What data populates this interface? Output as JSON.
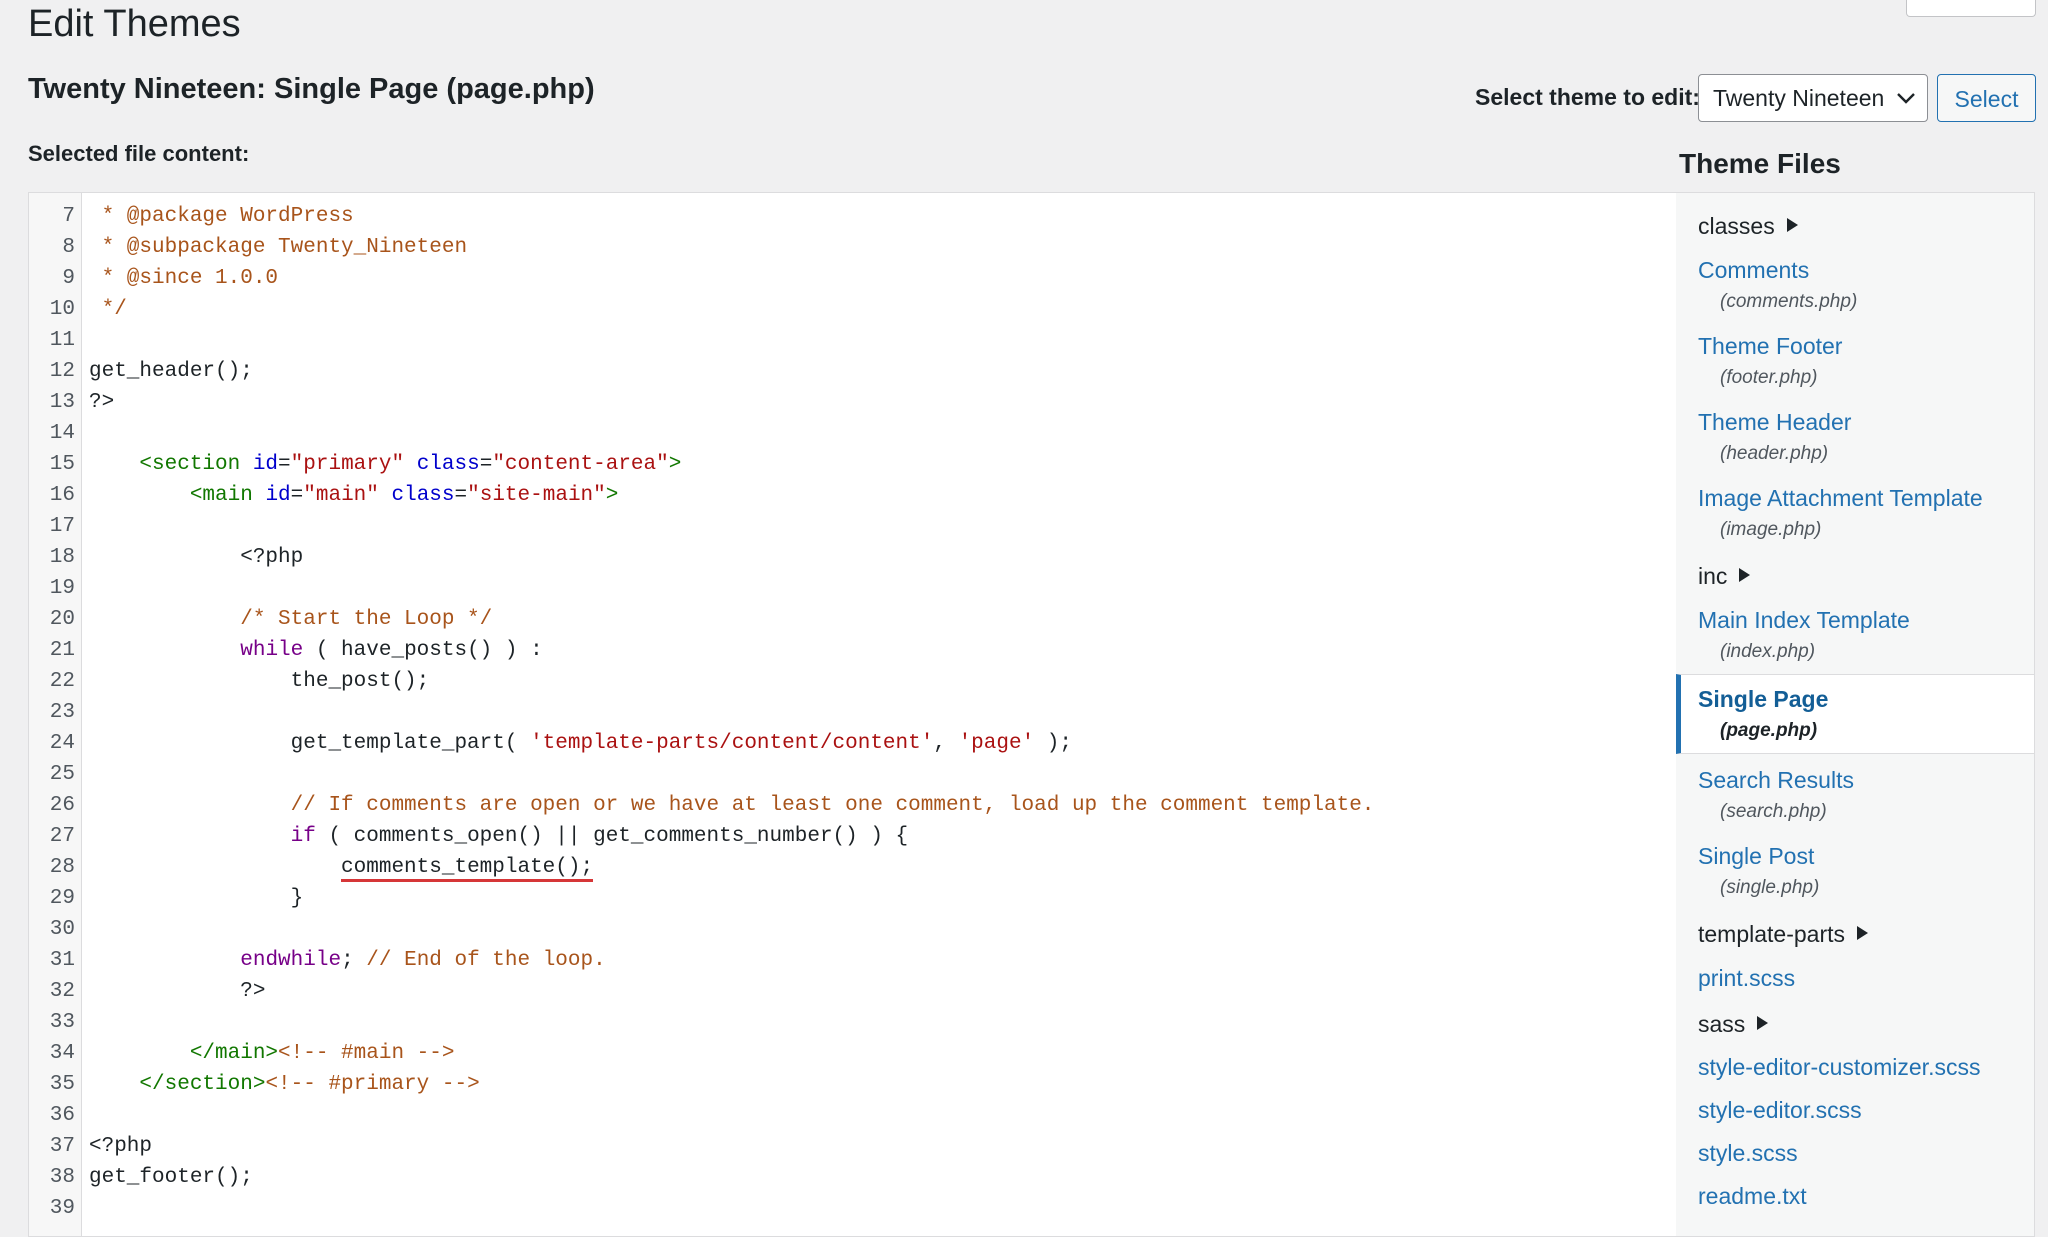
{
  "header": {
    "page_title": "Edit Themes",
    "file_title": "Twenty Nineteen: Single Page (page.php)",
    "select_theme_label": "Select theme to edit:",
    "selected_theme": "Twenty Nineteen",
    "select_button": "Select",
    "selected_file_label": "Selected file content:"
  },
  "editor": {
    "lines": [
      {
        "n": "7"
      },
      {
        "n": "8"
      },
      {
        "n": "9"
      },
      {
        "n": "10"
      },
      {
        "n": "11"
      },
      {
        "n": "12"
      },
      {
        "n": "13"
      },
      {
        "n": "14"
      },
      {
        "n": "15"
      },
      {
        "n": "16"
      },
      {
        "n": "17"
      },
      {
        "n": "18"
      },
      {
        "n": "19"
      },
      {
        "n": "20"
      },
      {
        "n": "21"
      },
      {
        "n": "22"
      },
      {
        "n": "23"
      },
      {
        "n": "24"
      },
      {
        "n": "25"
      },
      {
        "n": "26"
      },
      {
        "n": "27"
      },
      {
        "n": "28"
      },
      {
        "n": "29"
      },
      {
        "n": "30"
      },
      {
        "n": "31"
      },
      {
        "n": "32"
      },
      {
        "n": "33"
      },
      {
        "n": "34"
      },
      {
        "n": "35"
      },
      {
        "n": "36"
      },
      {
        "n": "37"
      },
      {
        "n": "38"
      },
      {
        "n": "39"
      }
    ],
    "code": {
      "l7": " * @package WordPress",
      "l8": " * @subpackage Twenty_Nineteen",
      "l9": " * @since 1.0.0",
      "l10": " */",
      "l12": "get_header();",
      "l13": "?>",
      "l15_a": "    <section ",
      "l15_b": "id",
      "l15_c": "=",
      "l15_d": "\"primary\"",
      "l15_e": " ",
      "l15_f": "class",
      "l15_g": "=",
      "l15_h": "\"content-area\"",
      "l15_i": ">",
      "l16_a": "        <main ",
      "l16_b": "id",
      "l16_c": "=",
      "l16_d": "\"main\"",
      "l16_e": " ",
      "l16_f": "class",
      "l16_g": "=",
      "l16_h": "\"site-main\"",
      "l16_i": ">",
      "l18": "            <?php",
      "l20": "            /* Start the Loop */",
      "l21_a": "            ",
      "l21_b": "while",
      "l21_c": " ( have_posts() ) :",
      "l22": "                the_post();",
      "l24_a": "                get_template_part( ",
      "l24_b": "'template-parts/content/content'",
      "l24_c": ", ",
      "l24_d": "'page'",
      "l24_e": " );",
      "l26": "                // If comments are open or we have at least one comment, load up the comment template.",
      "l27_a": "                ",
      "l27_b": "if",
      "l27_c": " ( comments_open() || get_comments_number() ) {",
      "l28_a": "                    ",
      "l28_b": "comments_template();",
      "l29": "                }",
      "l31_a": "            ",
      "l31_b": "endwhile",
      "l31_c": "; ",
      "l31_d": "// End of the loop.",
      "l32": "            ?>",
      "l34_a": "        </main>",
      "l34_b": "<!-- #main -->",
      "l35_a": "    </section>",
      "l35_b": "<!-- #primary -->",
      "l37": "<?php",
      "l38": "get_footer();"
    }
  },
  "sidebar": {
    "title": "Theme Files",
    "dirs": {
      "classes": "classes",
      "inc": "inc",
      "template_parts": "template-parts",
      "sass": "sass"
    },
    "files": {
      "comments": {
        "label": "Comments",
        "file": "(comments.php)"
      },
      "footer": {
        "label": "Theme Footer",
        "file": "(footer.php)"
      },
      "header": {
        "label": "Theme Header",
        "file": "(header.php)"
      },
      "image": {
        "label": "Image Attachment Template",
        "file": "(image.php)"
      },
      "index": {
        "label": "Main Index Template",
        "file": "(index.php)"
      },
      "page": {
        "label": "Single Page",
        "file": "(page.php)"
      },
      "search": {
        "label": "Search Results",
        "file": "(search.php)"
      },
      "single": {
        "label": "Single Post",
        "file": "(single.php)"
      },
      "print": {
        "label": "print.scss"
      },
      "style_editor_customizer": {
        "label": "style-editor-customizer.scss"
      },
      "style_editor": {
        "label": "style-editor.scss"
      },
      "style": {
        "label": "style.scss"
      },
      "readme": {
        "label": "readme.txt"
      }
    }
  },
  "colors": {
    "accent": "#2271b1",
    "comment": "#a8541b",
    "keyword": "#770088",
    "tag": "#117700",
    "attribute": "#0000cc",
    "string": "#aa1111",
    "error_underline": "#d63638"
  },
  "icons": {
    "select_chevron": "chevron-down-icon",
    "folder_toggle": "caret-right-icon"
  }
}
